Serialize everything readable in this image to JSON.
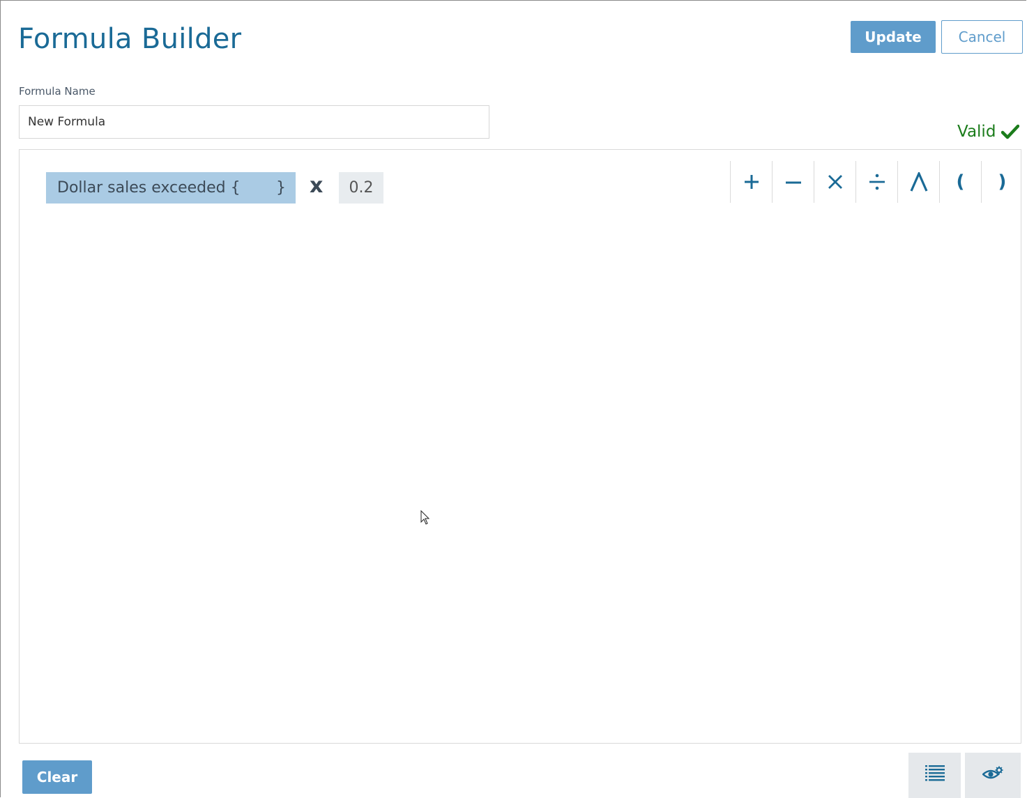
{
  "header": {
    "title": "Formula Builder",
    "update_label": "Update",
    "cancel_label": "Cancel"
  },
  "formula_name": {
    "label": "Formula Name",
    "value": "New Formula"
  },
  "status": {
    "text": "Valid",
    "icon": "check-icon",
    "color": "#1b7c1b"
  },
  "editor": {
    "tokens": [
      {
        "type": "field",
        "prefix": "Dollar sales exceeded {",
        "suffix": "}"
      },
      {
        "type": "operator",
        "text": "x"
      },
      {
        "type": "number",
        "text": "0.2"
      }
    ],
    "operators": [
      {
        "name": "plus",
        "icon": "plus-icon"
      },
      {
        "name": "minus",
        "icon": "minus-icon"
      },
      {
        "name": "multiply",
        "icon": "multiply-icon"
      },
      {
        "name": "divide",
        "icon": "divide-icon"
      },
      {
        "name": "power",
        "icon": "caret-icon"
      },
      {
        "name": "open-paren",
        "text": "("
      },
      {
        "name": "close-paren",
        "text": ")"
      }
    ]
  },
  "footer": {
    "clear_label": "Clear",
    "tools": [
      {
        "name": "field-list",
        "icon": "list-icon"
      },
      {
        "name": "preview",
        "icon": "eye-gear-icon"
      }
    ]
  },
  "colors": {
    "primary": "#1a6a96",
    "button": "#5f9ccb",
    "token_field": "#aacbe4",
    "token_number": "#e8ecef"
  }
}
